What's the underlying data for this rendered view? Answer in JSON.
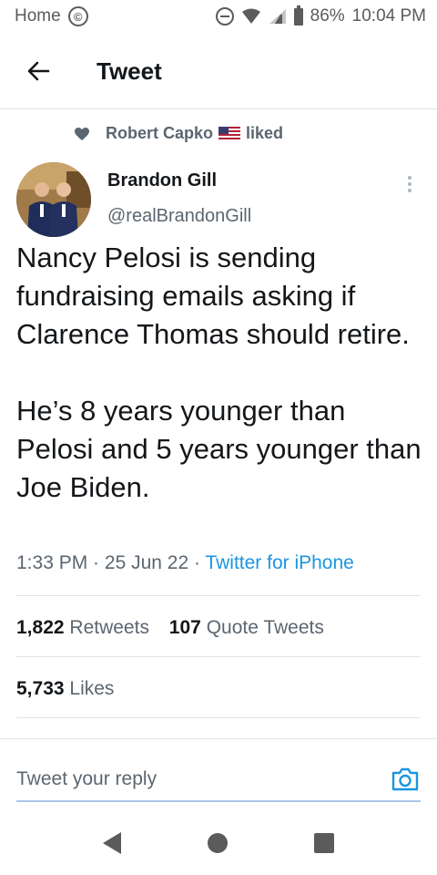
{
  "status_bar": {
    "left_label": "Home",
    "copyright_glyph": "©",
    "battery": "86%",
    "time": "10:04 PM"
  },
  "header": {
    "title": "Tweet"
  },
  "social_context": {
    "liker_name": "Robert Capko",
    "action": "liked"
  },
  "author": {
    "name": "Brandon Gill",
    "handle": "@realBrandonGill"
  },
  "tweet": {
    "paragraph_1": "Nancy Pelosi is sending fundraising emails asking if Clarence Thomas should retire.",
    "paragraph_2": "He’s 8 years younger than Pelosi and 5 years younger than Joe Biden.",
    "time": "1:33 PM",
    "date": "25 Jun 22",
    "separator": " · ",
    "source": "Twitter for iPhone"
  },
  "stats": {
    "retweets_count": "1,822",
    "retweets_label": "Retweets",
    "quotes_count": "107",
    "quotes_label": "Quote Tweets",
    "likes_count": "5,733",
    "likes_label": "Likes"
  },
  "reply": {
    "placeholder": "Tweet your reply"
  },
  "colors": {
    "link_blue": "#1b95e0",
    "secondary_text": "#5b6670",
    "primary_text": "#14171a"
  }
}
